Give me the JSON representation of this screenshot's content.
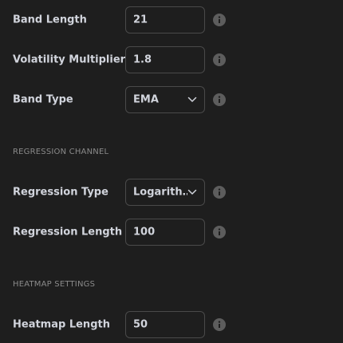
{
  "fields": {
    "band_length": {
      "label": "Band Length",
      "value": "21"
    },
    "volatility_multiplier": {
      "label": "Volatility Multiplier",
      "value": "1.8"
    },
    "band_type": {
      "label": "Band Type",
      "value": "EMA"
    },
    "regression_type": {
      "label": "Regression Type",
      "value": "Logarith…"
    },
    "regression_length": {
      "label": "Regression Length",
      "value": "100"
    },
    "heatmap_length": {
      "label": "Heatmap Length",
      "value": "50"
    }
  },
  "sections": {
    "regression_channel": "REGRESSION CHANNEL",
    "heatmap_settings": "HEATMAP SETTINGS"
  },
  "icons": {
    "info": "info-icon",
    "dropdown": "chevron-down-icon"
  },
  "colors": {
    "background": "#1e1e1e",
    "field_border": "#4a4a4a",
    "text": "#d1d4dc",
    "section_text": "#8a8a8a",
    "info_icon": "#5d5d5d"
  }
}
